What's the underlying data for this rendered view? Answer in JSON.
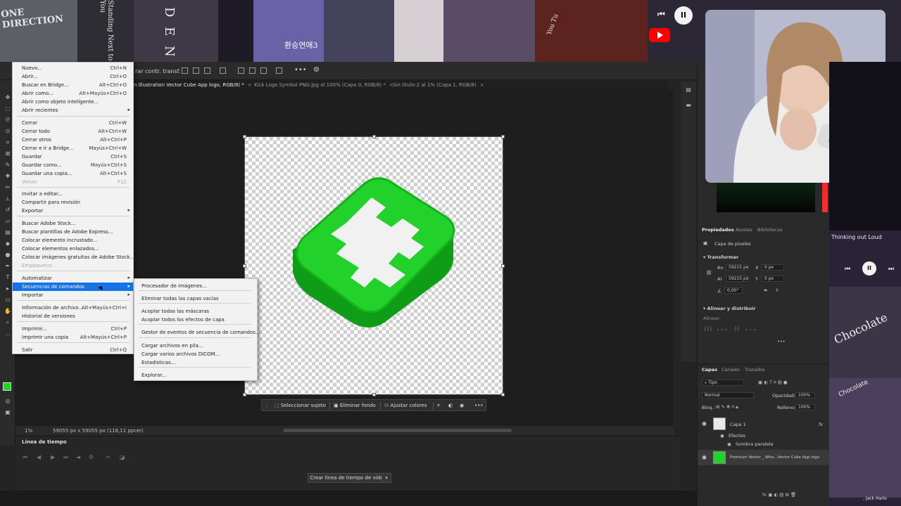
{
  "collage": {
    "band_text": "ONE DIRECTION",
    "tile2_text": "Standing Next to You",
    "tile3_text": "D E N",
    "tile5_text": "환승연애3",
    "tile9_text": "You Tu",
    "yt_icon": "youtube-icon"
  },
  "optionsbar": {
    "transform_label": "rar contr. transf."
  },
  "tabs": [
    {
      "label": "n Illustration Vector Cube App logo, RGB/8) *",
      "active": true
    },
    {
      "label": "Kick Logo Symbol PNG.jpg al 100% (Capa 0, RGB/8) *",
      "active": false
    },
    {
      "label": "Sin título-2 al 1% (Capa 1, RGB/8)",
      "active": false
    }
  ],
  "file_menu": {
    "items": [
      {
        "label": "Nuevo...",
        "shortcut": "Ctrl+N"
      },
      {
        "label": "Abrir...",
        "shortcut": "Ctrl+O"
      },
      {
        "label": "Buscar en Bridge...",
        "shortcut": "Alt+Ctrl+O"
      },
      {
        "label": "Abrir como...",
        "shortcut": "Alt+Mayús+Ctrl+O"
      },
      {
        "label": "Abrir como objeto inteligente...",
        "shortcut": ""
      },
      {
        "label": "Abrir recientes",
        "shortcut": "",
        "submenu": true
      },
      {
        "label": "Cerrar",
        "shortcut": "Ctrl+W"
      },
      {
        "label": "Cerrar todo",
        "shortcut": "Alt+Ctrl+W"
      },
      {
        "label": "Cerrar otros",
        "shortcut": "Alt+Ctrl+P"
      },
      {
        "label": "Cerrar e ir a Bridge...",
        "shortcut": "Mayús+Ctrl+W"
      },
      {
        "label": "Guardar",
        "shortcut": "Ctrl+S"
      },
      {
        "label": "Guardar como...",
        "shortcut": "Mayús+Ctrl+S"
      },
      {
        "label": "Guardar una copia...",
        "shortcut": "Alt+Ctrl+S"
      },
      {
        "label": "Volver",
        "shortcut": "F12",
        "disabled": true
      },
      {
        "label": "Invitar a editar...",
        "shortcut": ""
      },
      {
        "label": "Compartir para revisión",
        "shortcut": ""
      },
      {
        "label": "Exportar",
        "shortcut": "",
        "submenu": true
      },
      {
        "label": "Buscar Adobe Stock...",
        "shortcut": ""
      },
      {
        "label": "Buscar plantillas de Adobe Express...",
        "shortcut": ""
      },
      {
        "label": "Colocar elemento incrustado...",
        "shortcut": ""
      },
      {
        "label": "Colocar elementos enlazados...",
        "shortcut": ""
      },
      {
        "label": "Colocar imágenes gratuitas de Adobe Stock...",
        "shortcut": ""
      },
      {
        "label": "Empaquetar...",
        "shortcut": "",
        "disabled": true
      },
      {
        "label": "Automatizar",
        "shortcut": "",
        "submenu": true
      },
      {
        "label": "Secuencias de comandos",
        "shortcut": "",
        "submenu": true,
        "highlighted": true
      },
      {
        "label": "Importar",
        "shortcut": "",
        "submenu": true
      },
      {
        "label": "Información de archivo...",
        "shortcut": "Alt+Mayús+Ctrl+I"
      },
      {
        "label": "Historial de versiones",
        "shortcut": ""
      },
      {
        "label": "Imprimir...",
        "shortcut": "Ctrl+P"
      },
      {
        "label": "Imprimir una copia",
        "shortcut": "Alt+Mayús+Ctrl+P"
      },
      {
        "label": "Salir",
        "shortcut": "Ctrl+Q"
      }
    ]
  },
  "scripts_submenu": {
    "items": [
      "Procesador de imágenes...",
      "Eliminar todas las capas vacías",
      "Acoplar todas las máscaras",
      "Acoplar todos los efectos de capa",
      "Gestor de eventos de secuencia de comandos...",
      "Cargar archivos en pila...",
      "Cargar varios archivos DICOM...",
      "Estadísticas...",
      "Explorar..."
    ]
  },
  "context_bar": {
    "select_subject": "Seleccionar sujeto",
    "remove_bg": "Eliminar fondo",
    "adjust_colors": "Ajustar colores"
  },
  "status": {
    "zoom": "1%",
    "doc_info": "59055 px x 59055 px (118,11 ppcm)"
  },
  "timeline": {
    "title": "Línea de tiempo",
    "create_button": "Crear línea de tiempo de vídeo"
  },
  "properties": {
    "tabs": [
      "Propiedades",
      "Ajustes",
      "Bibliotecas"
    ],
    "layer_type": "Capa de píxeles",
    "transform_title": "Transformar",
    "w_label": "An",
    "w_value": "59215 px",
    "h_label": "Al",
    "h_value": "59215 px",
    "x_label": "X",
    "x_value": "0 px",
    "y_label": "Y",
    "y_value": "0 px",
    "angle_value": "0,00°",
    "align_title": "Alinear y distribuir",
    "align_label": "Alinear:"
  },
  "layers": {
    "tabs": [
      "Capas",
      "Canales",
      "Trazados"
    ],
    "filter": "Tipo",
    "blend_mode": "Normal",
    "opacity_label": "Opacidad:",
    "opacity": "100%",
    "lock_label": "Bloq.:",
    "fill_label": "Relleno:",
    "fill": "100%",
    "items": [
      {
        "name": "Capa 1",
        "fx": "fx"
      },
      {
        "name": "Efectos"
      },
      {
        "name": "Sombra paralela"
      },
      {
        "name": "Premium Vector _ Wha...Vector Cube App logo"
      }
    ]
  },
  "music": {
    "track": "Thinking out Loud",
    "album_text": "Chocolate",
    "album_text2": "Chocolate",
    "artist": ", Jack Harlo"
  },
  "colors": {
    "accent": "#1473e6",
    "logo_green": "#22d12a",
    "logo_dark_green": "#0f9d17"
  }
}
